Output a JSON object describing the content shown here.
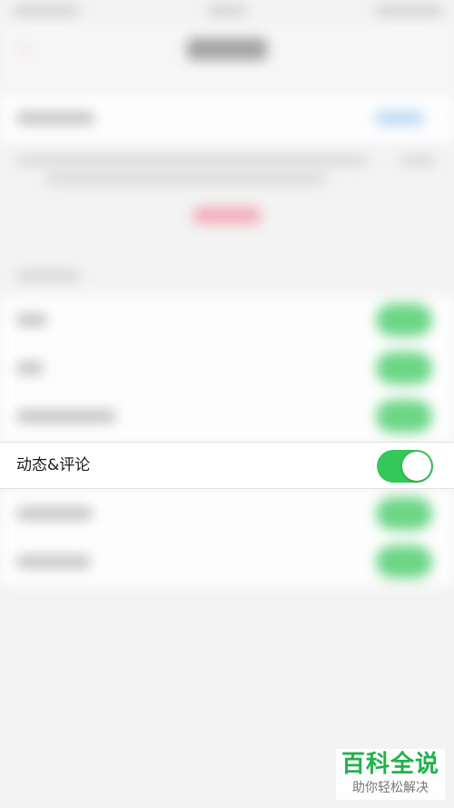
{
  "focused_row": {
    "label": "动态&评论",
    "toggle_on": true,
    "toggle_color": "#34c759"
  },
  "watermark": {
    "title": "百科全说",
    "subtitle": "助你轻松解决"
  },
  "colors": {
    "background": "#f3f3f3",
    "row_background": "#ffffff",
    "accent_pink": "#f3a3b1",
    "accent_blue": "#b9d8f5"
  }
}
